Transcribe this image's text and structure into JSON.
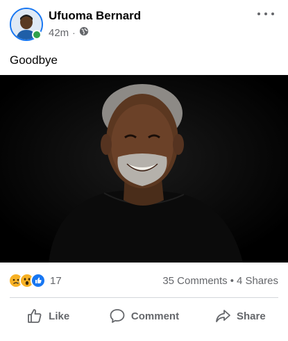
{
  "post": {
    "author": "Ufuoma Bernard",
    "time": "42m",
    "separator": "·",
    "privacy_icon": "globe-icon",
    "text": "Goodbye"
  },
  "stats": {
    "reaction_icons": [
      "sad-icon",
      "wow-icon",
      "like-icon"
    ],
    "reaction_count": "17",
    "comments": "35 Comments",
    "dot": "•",
    "shares": "4 Shares"
  },
  "actions": {
    "like": "Like",
    "comment": "Comment",
    "share": "Share"
  },
  "colors": {
    "brand": "#1877f2",
    "online": "#31a24c",
    "secondary_text": "#65676b"
  }
}
